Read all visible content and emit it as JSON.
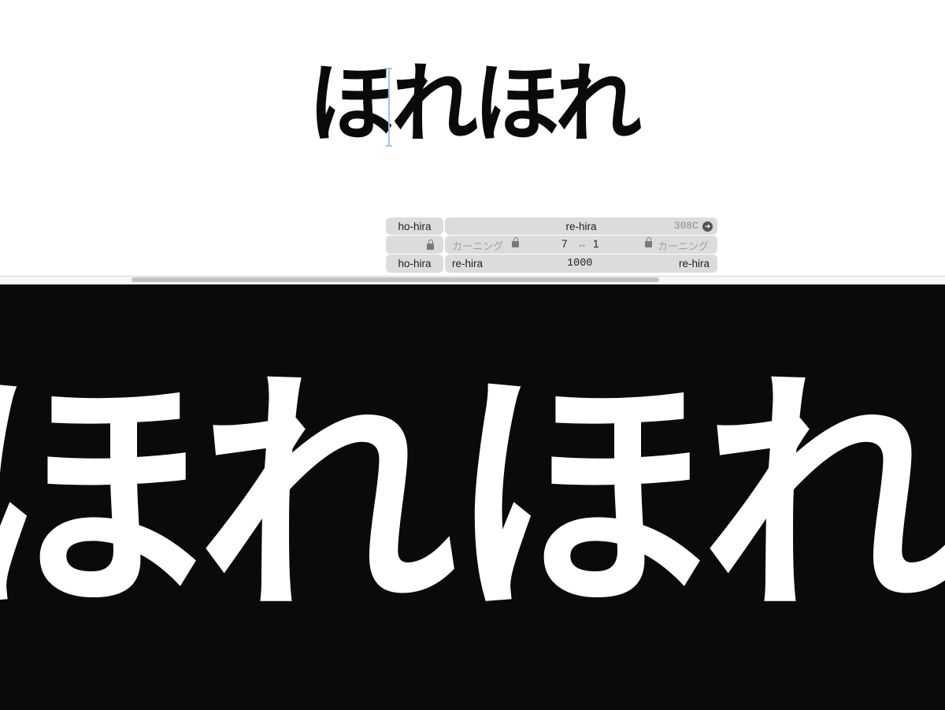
{
  "editor": {
    "glyphs": [
      "ほ",
      "れ",
      "ほ",
      "れ"
    ]
  },
  "kerning_panel": {
    "left_glyph": "ho-hira",
    "right_glyph": "re-hira",
    "unicode": "308C",
    "kerning_label_left": "カーニング",
    "kerning_label_right": "カーニング",
    "kern_value_left": "7",
    "kern_value_right": "1",
    "left_group": "ho-hira",
    "right_group_left": "re-hira",
    "width": "1000",
    "right_group_right": "re-hira"
  },
  "preview": {
    "text": "ほれほれ"
  },
  "colors": {
    "preview_bg": "#0a0a0a",
    "panel_bg": "#dcdcdc",
    "cursor": "#9fc3ee"
  },
  "icons": [
    "lock-icon",
    "go-arrow-icon",
    "kerning-arrows-icon"
  ]
}
